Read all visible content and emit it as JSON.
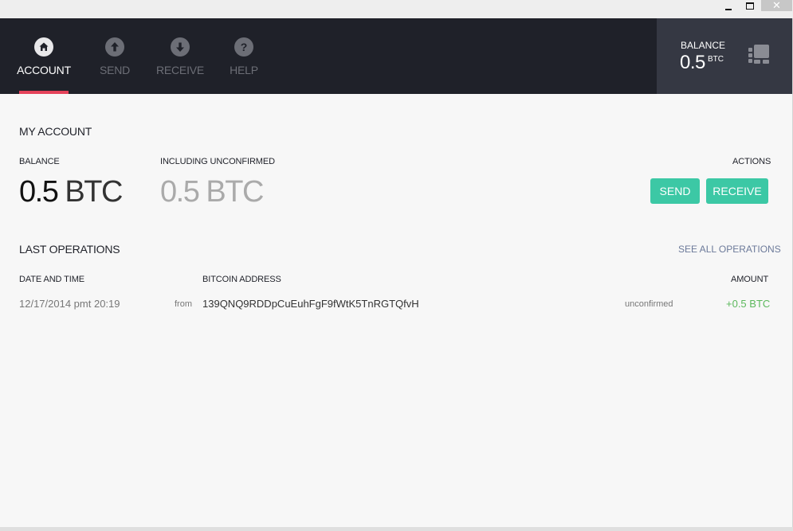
{
  "window": {
    "controls": {
      "minimize": "minimize",
      "maximize": "maximize",
      "close": "✕"
    }
  },
  "nav": {
    "items": [
      {
        "label": "ACCOUNT",
        "icon": "home-icon",
        "active": true
      },
      {
        "label": "SEND",
        "icon": "arrow-up-icon",
        "active": false
      },
      {
        "label": "RECEIVE",
        "icon": "arrow-down-icon",
        "active": false
      },
      {
        "label": "HELP",
        "icon": "question-icon",
        "active": false
      }
    ],
    "accent_color": "#e5435a"
  },
  "header_balance": {
    "label": "BALANCE",
    "value": "0.5",
    "unit": "BTC",
    "icon": "wallet-icon"
  },
  "account": {
    "title": "MY ACCOUNT",
    "balance_label": "BALANCE",
    "balance_value": "0.5",
    "balance_unit": "BTC",
    "unconfirmed_label": "INCLUDING UNCONFIRMED",
    "unconfirmed_value": "0.5",
    "unconfirmed_unit": "BTC",
    "actions_label": "ACTIONS",
    "send_button": "SEND",
    "receive_button": "RECEIVE",
    "button_color": "#3cc8a5"
  },
  "operations": {
    "title": "LAST OPERATIONS",
    "see_all": "SEE ALL OPERATIONS",
    "columns": {
      "date": "DATE AND TIME",
      "address": "BITCOIN ADDRESS",
      "amount": "AMOUNT"
    },
    "rows": [
      {
        "date": "12/17/2014 pmt 20:19",
        "direction": "from",
        "address": "139QNQ9RDDpCuEuhFgF9fWtK5TnRGTQfvH",
        "status": "unconfirmed",
        "amount": "+0.5 BTC",
        "amount_color": "#5cb85c"
      }
    ]
  }
}
